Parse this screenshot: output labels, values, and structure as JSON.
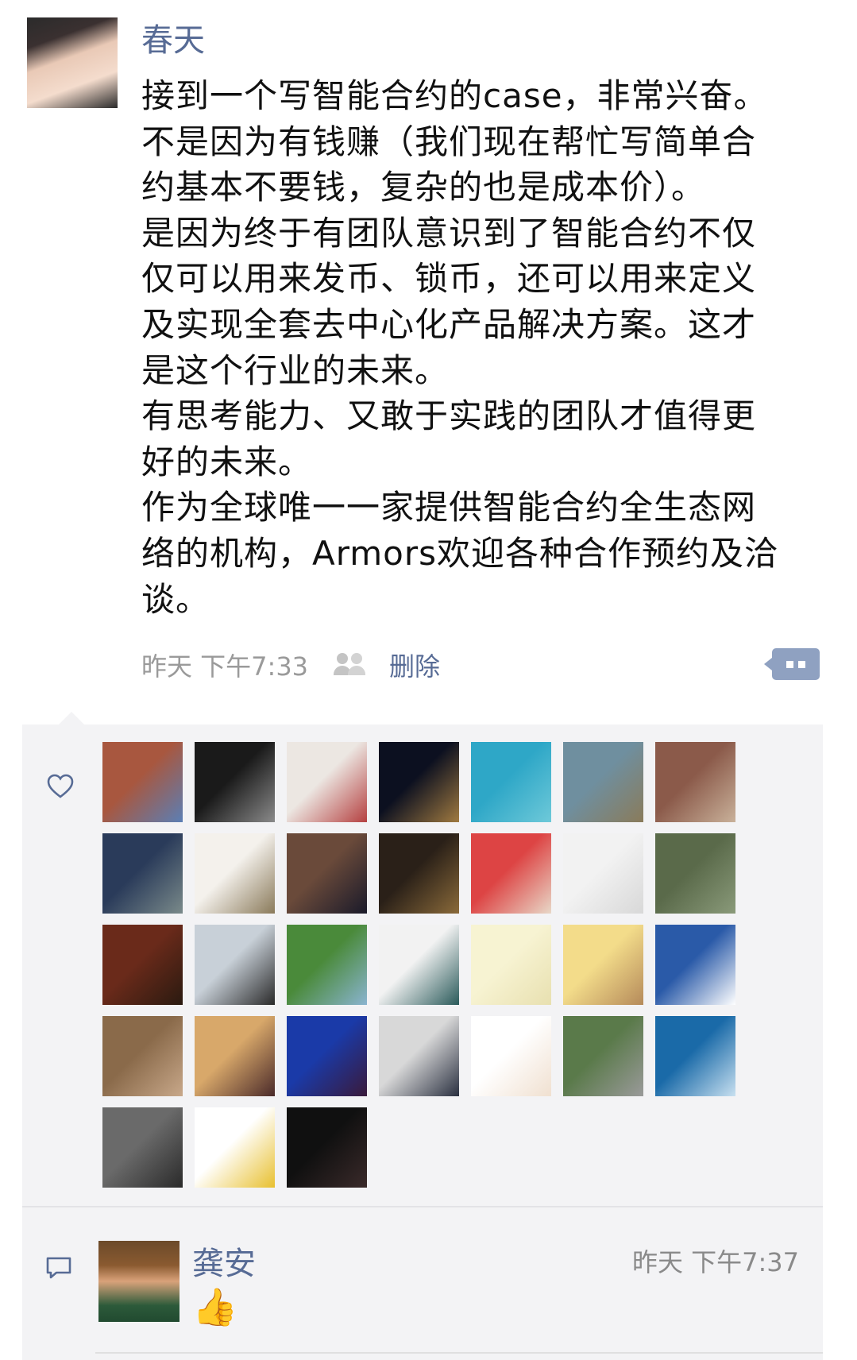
{
  "post": {
    "author": "春天",
    "lines": [
      "接到一个写智能合约的case，非常兴奋。",
      "不是因为有钱赚（我们现在帮忙写简单合",
      "约基本不要钱，复杂的也是成本价）。",
      "是因为终于有团队意识到了智能合约不仅",
      "仅可以用来发币、锁币，还可以用来定义",
      "及实现全套去中心化产品解决方案。这才",
      "是这个行业的未来。",
      "有思考能力、又敢于实践的团队才值得更",
      "好的未来。",
      "作为全球唯一一家提供智能合约全生态网",
      "络的机构，Armors欢迎各种合作预约及洽",
      "谈。"
    ],
    "time": "昨天 下午7:33",
    "delete_label": "删除"
  },
  "likes": {
    "avatars": [
      {
        "c1": "#a8573f",
        "c2": "#5b7fb5"
      },
      {
        "c1": "#1a1a1a",
        "c2": "#8a8a8a"
      },
      {
        "c1": "#ece7e2",
        "c2": "#b54040"
      },
      {
        "c1": "#0c1020",
        "c2": "#a07a40"
      },
      {
        "c1": "#2ea7c7",
        "c2": "#6ec9d9"
      },
      {
        "c1": "#6f8f9f",
        "c2": "#8a7b5a"
      },
      {
        "c1": "#8b5a4a",
        "c2": "#c9b19a"
      },
      {
        "c1": "#2a3b5a",
        "c2": "#7a8a8a"
      },
      {
        "c1": "#f4f1ec",
        "c2": "#8a7a5a"
      },
      {
        "c1": "#6a4a3a",
        "c2": "#1a1a2a"
      },
      {
        "c1": "#2a2018",
        "c2": "#8a6a3a"
      },
      {
        "c1": "#d44",
        "c2": "#e8d8c8"
      },
      {
        "c1": "#f2f2f2",
        "c2": "#d8d8d8"
      },
      {
        "c1": "#5a6a4a",
        "c2": "#8a9a7a"
      },
      {
        "c1": "#6a2a1a",
        "c2": "#2a1a10"
      },
      {
        "c1": "#c8d0d8",
        "c2": "#2a2a2a"
      },
      {
        "c1": "#4a8a3a",
        "c2": "#8ab4d0"
      },
      {
        "c1": "#f2f2f2",
        "c2": "#2a5a5a"
      },
      {
        "c1": "#f7f3d2",
        "c2": "#e8e0b0"
      },
      {
        "c1": "#f3dc8a",
        "c2": "#b58a5a"
      },
      {
        "c1": "#2a5aa8",
        "c2": "#ffffff"
      },
      {
        "c1": "#8a6a4a",
        "c2": "#c8a88a"
      },
      {
        "c1": "#d8a86a",
        "c2": "#4a2a2a"
      },
      {
        "c1": "#1a3aa8",
        "c2": "#3a1a3a"
      },
      {
        "c1": "#d8d8d8",
        "c2": "#2a3040"
      },
      {
        "c1": "#ffffff",
        "c2": "#f0e0d0"
      },
      {
        "c1": "#5a7a4a",
        "c2": "#9a9a9a"
      },
      {
        "c1": "#1a6aa8",
        "c2": "#c8e0f0"
      },
      {
        "c1": "#6a6a6a",
        "c2": "#2a2a2a"
      },
      {
        "c1": "#ffffff",
        "c2": "#e8c030"
      },
      {
        "c1": "#101010",
        "c2": "#3a2a2a"
      }
    ]
  },
  "comment": {
    "author": "龚安",
    "time": "昨天 下午7:37",
    "text": "👍"
  },
  "colors": {
    "link": "#576b95",
    "panel": "#f3f3f5",
    "meta_gray": "#9a9a9a"
  }
}
